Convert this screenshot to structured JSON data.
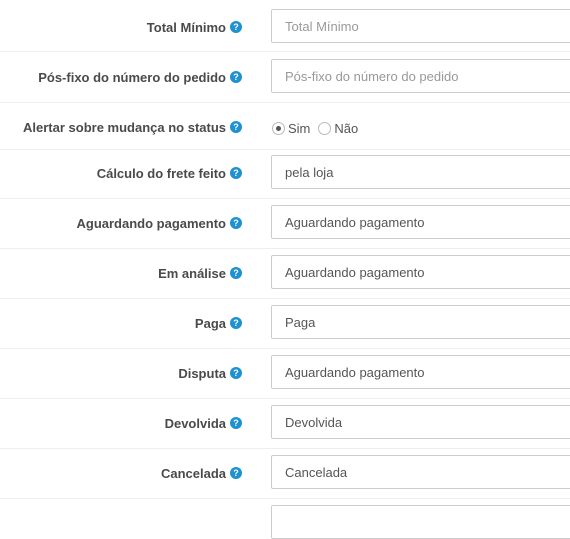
{
  "help_glyph": "?",
  "fields": [
    {
      "label": "Total Mínimo",
      "value": "",
      "placeholder": "Total Mínimo"
    },
    {
      "label": "Pós-fixo do número do pedido",
      "value": "",
      "placeholder": "Pós-fixo do número do pedido"
    },
    {
      "label": "Alertar sobre mudança no status",
      "options": [
        "Sim",
        "Não"
      ],
      "selected": "Sim"
    },
    {
      "label": "Cálculo do frete feito",
      "value": "pela loja"
    },
    {
      "label": "Aguardando pagamento",
      "value": "Aguardando pagamento"
    },
    {
      "label": "Em análise",
      "value": "Aguardando pagamento"
    },
    {
      "label": "Paga",
      "value": "Paga"
    },
    {
      "label": "Disputa",
      "value": "Aguardando pagamento"
    },
    {
      "label": "Devolvida",
      "value": "Devolvida"
    },
    {
      "label": "Cancelada",
      "value": "Cancelada"
    }
  ],
  "colors": {
    "help_icon": "#1e91cf",
    "label": "#4a4a4a",
    "border": "#cccccc"
  }
}
